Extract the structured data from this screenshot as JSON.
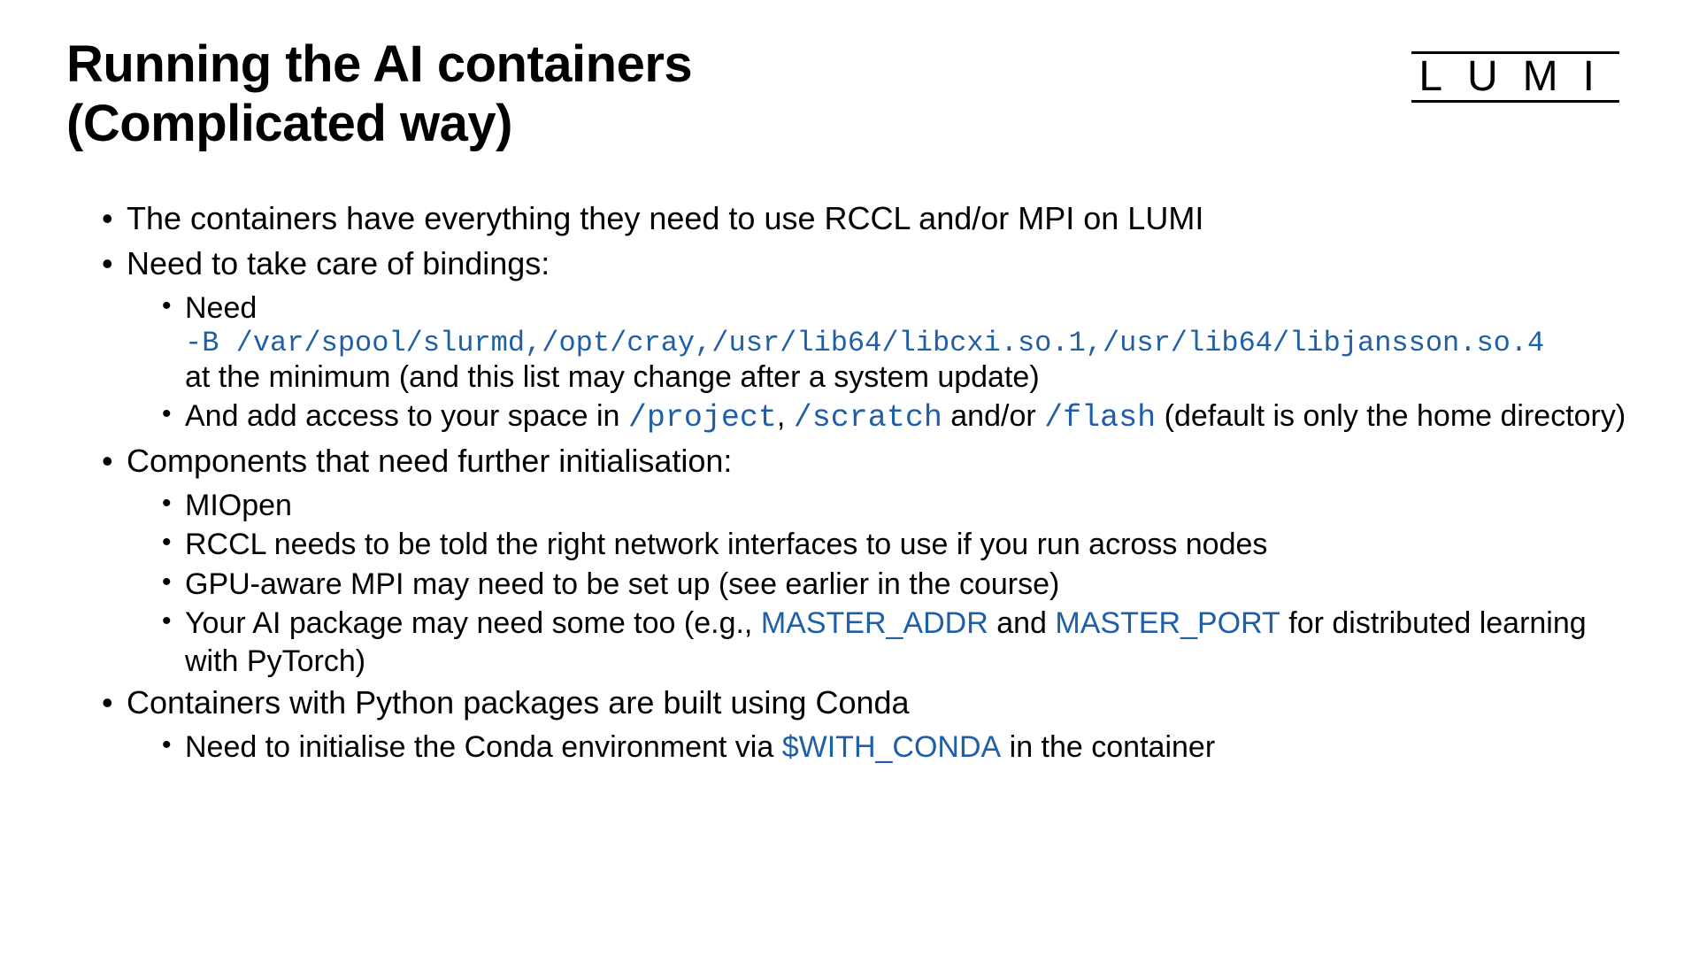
{
  "header": {
    "title_line1": "Running the AI containers",
    "title_line2": "(Complicated way)",
    "logo_text": "LUMI"
  },
  "bullets": {
    "b1": "The containers have everything they need to use RCCL and/or MPI on LUMI",
    "b2": "Need to take care of bindings:",
    "b2_sub1_pre": "Need",
    "b2_sub1_code": "-B /var/spool/slurmd,/opt/cray,/usr/lib64/libcxi.so.1,/usr/lib64/libjansson.so.4",
    "b2_sub1_post": "at the minimum (and this list may change after a system update)",
    "b2_sub2_pre": "And add access to your space in ",
    "b2_sub2_code1": "/project",
    "b2_sub2_sep1": ", ",
    "b2_sub2_code2": "/scratch",
    "b2_sub2_sep2": " and/or ",
    "b2_sub2_code3": "/flash",
    "b2_sub2_post": " (default is only the home directory)",
    "b3": "Components that need further initialisation:",
    "b3_sub1": "MIOpen",
    "b3_sub2": "RCCL needs to be told the right network interfaces to use if you run across nodes",
    "b3_sub3": "GPU-aware MPI may need to be set up (see earlier in the course)",
    "b3_sub4_pre": "Your AI package may need some too (e.g., ",
    "b3_sub4_code1": "MASTER_ADDR",
    "b3_sub4_sep": " and ",
    "b3_sub4_code2": "MASTER_PORT",
    "b3_sub4_post": " for distributed learning with PyTorch)",
    "b4": "Containers with Python packages are built using Conda",
    "b4_sub1_pre": "Need to initialise the Conda environment via ",
    "b4_sub1_code": "$WITH_CONDA",
    "b4_sub1_post": " in the container"
  }
}
